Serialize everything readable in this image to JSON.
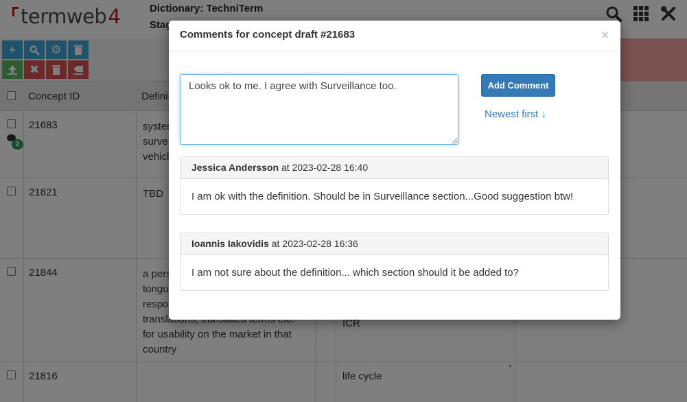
{
  "app": {
    "logo_text": "termweb",
    "logo_number": "4",
    "dictionary_label": "Dictionary: TechniTerm",
    "dictionary_sub": "Stag"
  },
  "top_icons": [
    "search-icon",
    "grid-icon",
    "tools-icon"
  ],
  "toolbar": {
    "buttons": [
      {
        "name": "add-icon",
        "glyph": "+",
        "color": "#3fa7d6"
      },
      {
        "name": "search-icon",
        "glyph": "🔍",
        "color": "#3fa7d6"
      },
      {
        "name": "gear-icon",
        "glyph": "⚙",
        "color": "#3fa7d6"
      },
      {
        "name": "trash-icon",
        "glyph": "🗑",
        "color": "#3fa7d6"
      },
      {
        "name": "upload-icon",
        "glyph": "⇧",
        "color": "#5cb85c"
      },
      {
        "name": "close-icon",
        "glyph": "✖",
        "color": "#d9534f"
      },
      {
        "name": "trash-icon",
        "glyph": "🗑",
        "color": "#d9534f"
      },
      {
        "name": "eraser-icon",
        "glyph": "⌫",
        "color": "#d9534f"
      }
    ]
  },
  "grid": {
    "headers": {
      "concept_id": "Concept ID",
      "definition": "Defini"
    },
    "rows": [
      {
        "id": "21683",
        "definition": [
          "syster",
          "surve",
          "vehicl"
        ],
        "term": "",
        "comment_count": "2"
      },
      {
        "id": "21821",
        "definition": [
          "TBD"
        ],
        "term": ""
      },
      {
        "id": "21844",
        "definition": [
          "a pers",
          "tongu",
          "respo",
          "translations, translated terms etc.",
          "for usability on the market in that",
          "country"
        ],
        "term": "ICR"
      },
      {
        "id": "21816",
        "definition": [
          ""
        ],
        "term": "life cycle",
        "required_mark": "*"
      }
    ]
  },
  "modal": {
    "title": "Comments for concept draft #21683",
    "close_glyph": "×",
    "input_value": "Looks ok to me. I agree with Surveillance too.",
    "add_button": "Add Comment",
    "sort_label": "Newest first ↓",
    "comments": [
      {
        "author": "Jessica Andersson",
        "timestamp": "at 2023-02-28 16:40",
        "text": "I am ok with the definition. Should be in Surveillance section...Good suggestion btw!"
      },
      {
        "author": "Ioannis Iakovidis",
        "timestamp": "at 2023-02-28 16:36",
        "text": "I am not sure about the definition... which section should it be added to?"
      }
    ]
  },
  "colors": {
    "accent": "#337ab7",
    "brand_red": "#b31b1b",
    "badge_green": "#2e9e5b",
    "alert_band": "#f3a5a5"
  }
}
